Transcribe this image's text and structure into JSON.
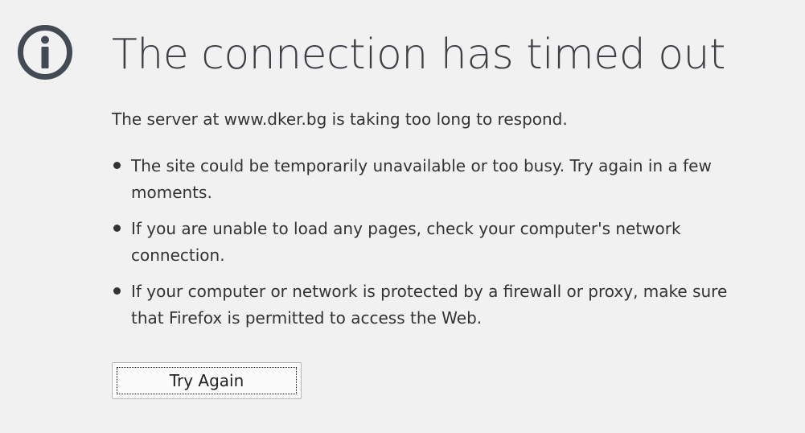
{
  "error": {
    "icon": "info-icon",
    "title": "The connection has timed out",
    "intro": "The server at www.dker.bg is taking too long to respond.",
    "reasons": [
      "The site could be temporarily unavailable or too busy. Try again in a few moments.",
      "If you are unable to load any pages, check your computer's network connection.",
      "If your computer or network is protected by a firewall or proxy, make sure that Firefox is permitted to access the Web."
    ],
    "button_label": "Try Again"
  },
  "colors": {
    "background": "#f1f1f1",
    "icon": "#434a54",
    "title": "#3d4045",
    "text": "#333333"
  }
}
